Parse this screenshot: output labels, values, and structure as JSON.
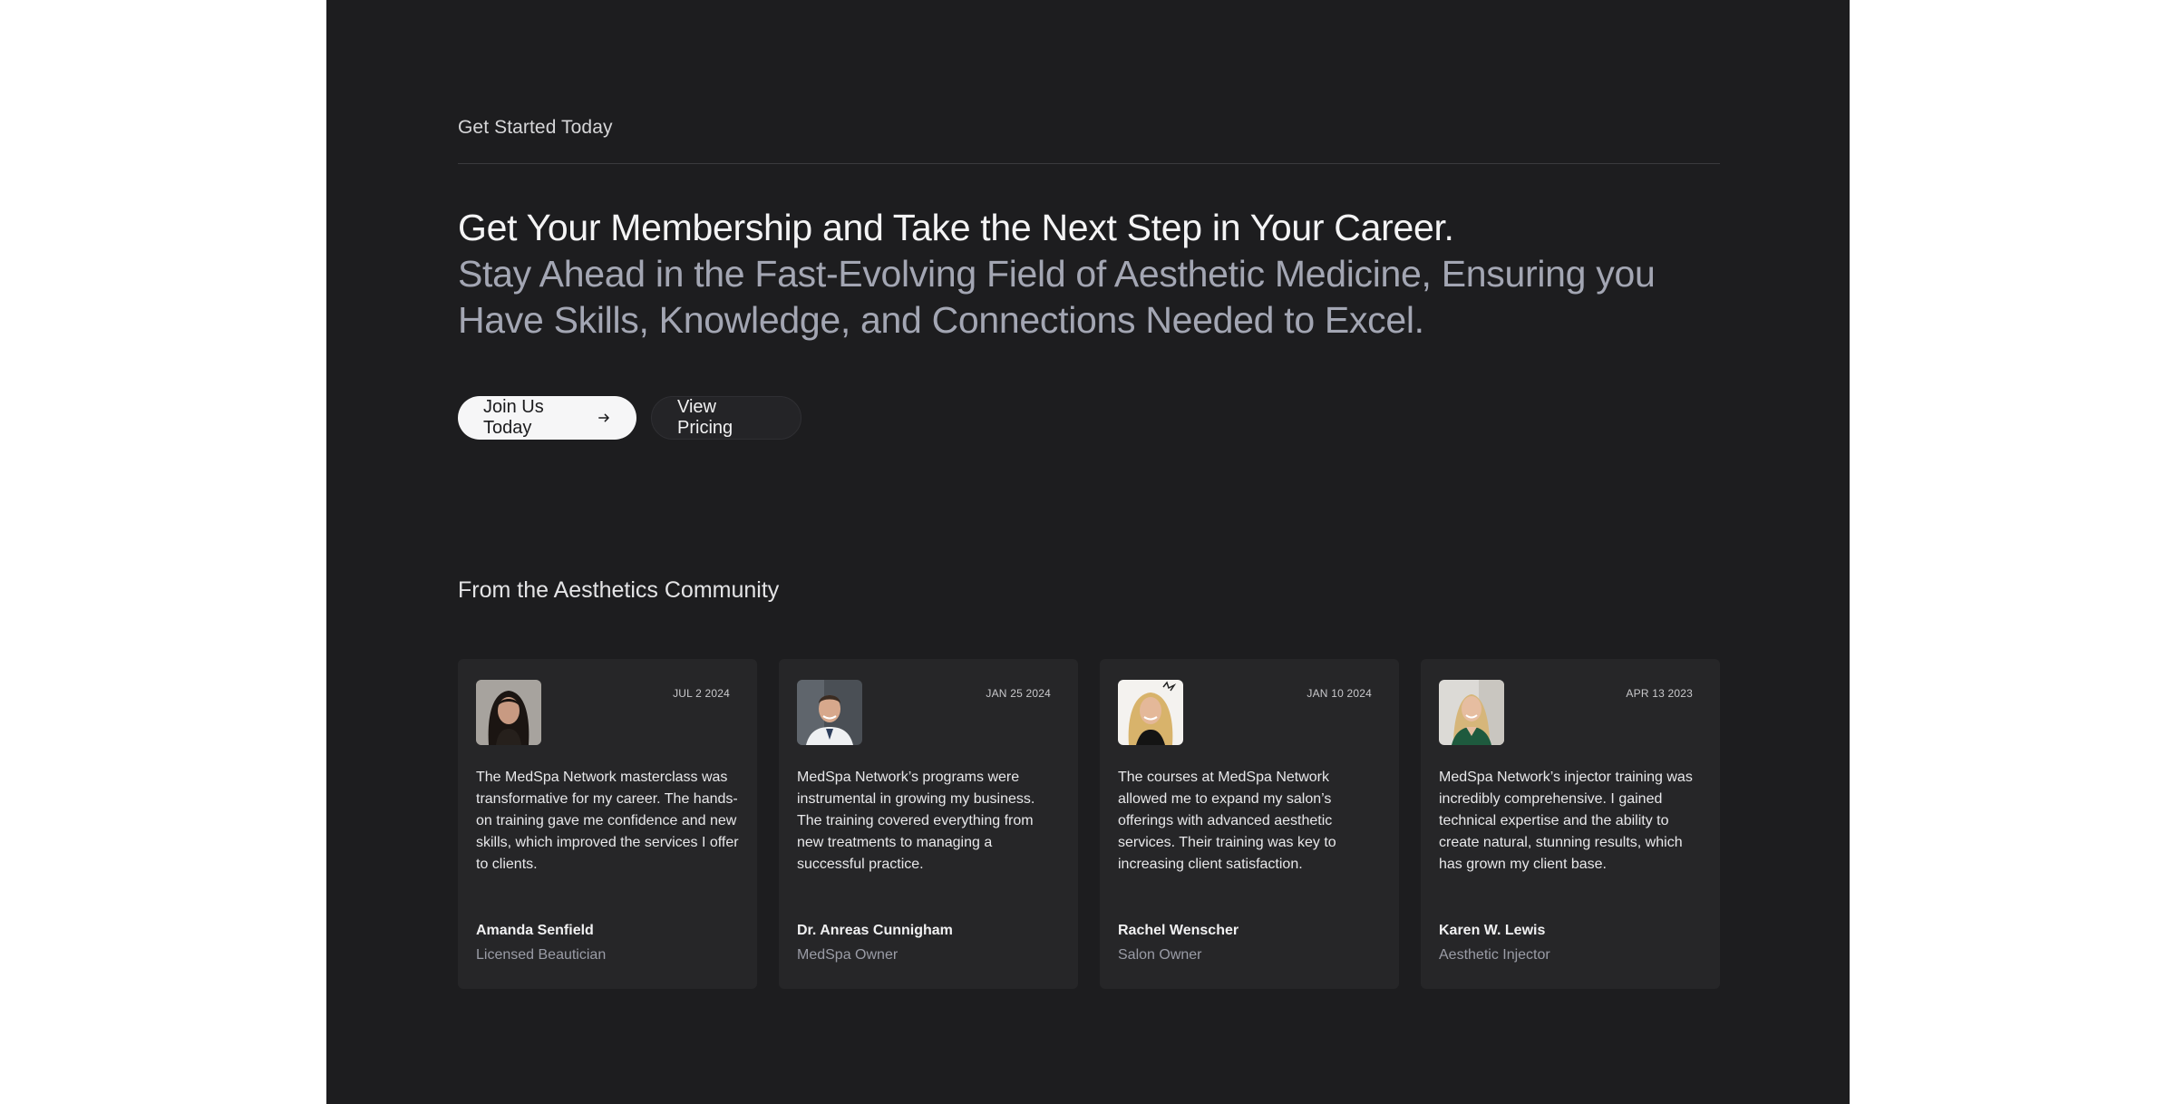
{
  "section": {
    "eyebrow": "Get Started Today",
    "headline_primary": "Get Your Membership and Take the Next Step in Your Career.",
    "headline_secondary": "Stay Ahead in the Fast-Evolving Field of Aesthetic Medicine, Ensuring you Have Skills, Knowledge, and Connections Needed to Excel."
  },
  "buttons": {
    "join_label": "Join Us Today",
    "pricing_label": "View Pricing"
  },
  "community": {
    "title": "From the Aesthetics Community",
    "testimonials": [
      {
        "date": "JUL 2 2024",
        "quote": "The MedSpa Network masterclass was transformative for my career. The hands-on training gave me confidence and new skills, which improved the services I offer to clients.",
        "name": "Amanda Senfield",
        "role": "Licensed Beautician"
      },
      {
        "date": "JAN 25 2024",
        "quote": "MedSpa Network’s programs were instrumental in growing my business. The training covered everything from new treatments to managing a successful practice.",
        "name": "Dr. Anreas Cunnigham",
        "role": "MedSpa Owner"
      },
      {
        "date": "JAN 10 2024",
        "quote": "The courses at MedSpa Network allowed me to expand my salon’s offerings with advanced aesthetic services. Their training was key to increasing client satisfaction.",
        "name": "Rachel Wenscher",
        "role": "Salon Owner"
      },
      {
        "date": "APR 13 2023",
        "quote": "MedSpa Network’s injector training was incredibly comprehensive. I gained technical expertise and the ability to create natural, stunning results, which has grown my client base.",
        "name": "Karen W. Lewis",
        "role": "Aesthetic Injector"
      }
    ]
  },
  "colors": {
    "panel_bg": "#1d1d1f",
    "card_bg": "#262628",
    "headline_muted": "#a3a6b3"
  }
}
